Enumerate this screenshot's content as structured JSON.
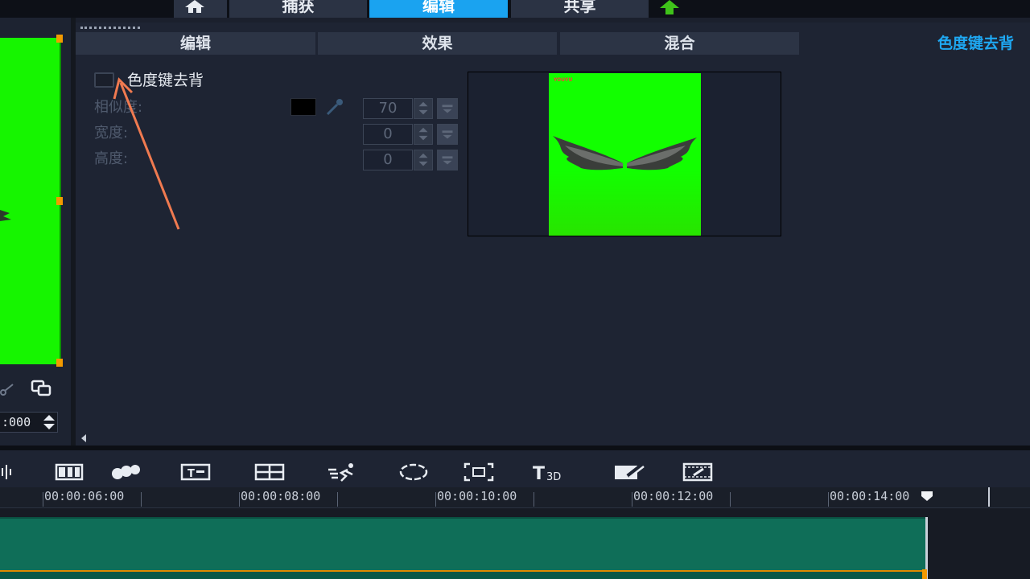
{
  "top_nav": {
    "tabs": [
      {
        "label": "捕获",
        "active": false
      },
      {
        "label": "编辑",
        "active": true
      },
      {
        "label": "共享",
        "active": false
      }
    ],
    "home_icon": "home-icon",
    "upload_icon": "upload-arrow-icon"
  },
  "left_panel": {
    "timecode": ":000"
  },
  "sub_tabs": {
    "items": [
      "编辑",
      "效果",
      "混合"
    ],
    "active_label": "色度键去背"
  },
  "chroma_key": {
    "checkbox_label": "色度键去背",
    "checked": false,
    "similarity_label": "相似度:",
    "width_label": "宽度:",
    "height_label": "高度:",
    "similarity_value": "70",
    "width_value": "0",
    "height_value": "0",
    "key_color": "#000000"
  },
  "preview_thumb": {
    "corner_text": "YOUYU",
    "background_color": "#12ff00"
  },
  "timeline": {
    "ruler_labels": [
      "00:00:06:00",
      "00:00:08:00",
      "00:00:10:00",
      "00:00:12:00",
      "00:00:14:00"
    ]
  },
  "colors": {
    "accent": "#1aa3f0",
    "clip": "#0f6e58",
    "marker": "#f39a00"
  }
}
